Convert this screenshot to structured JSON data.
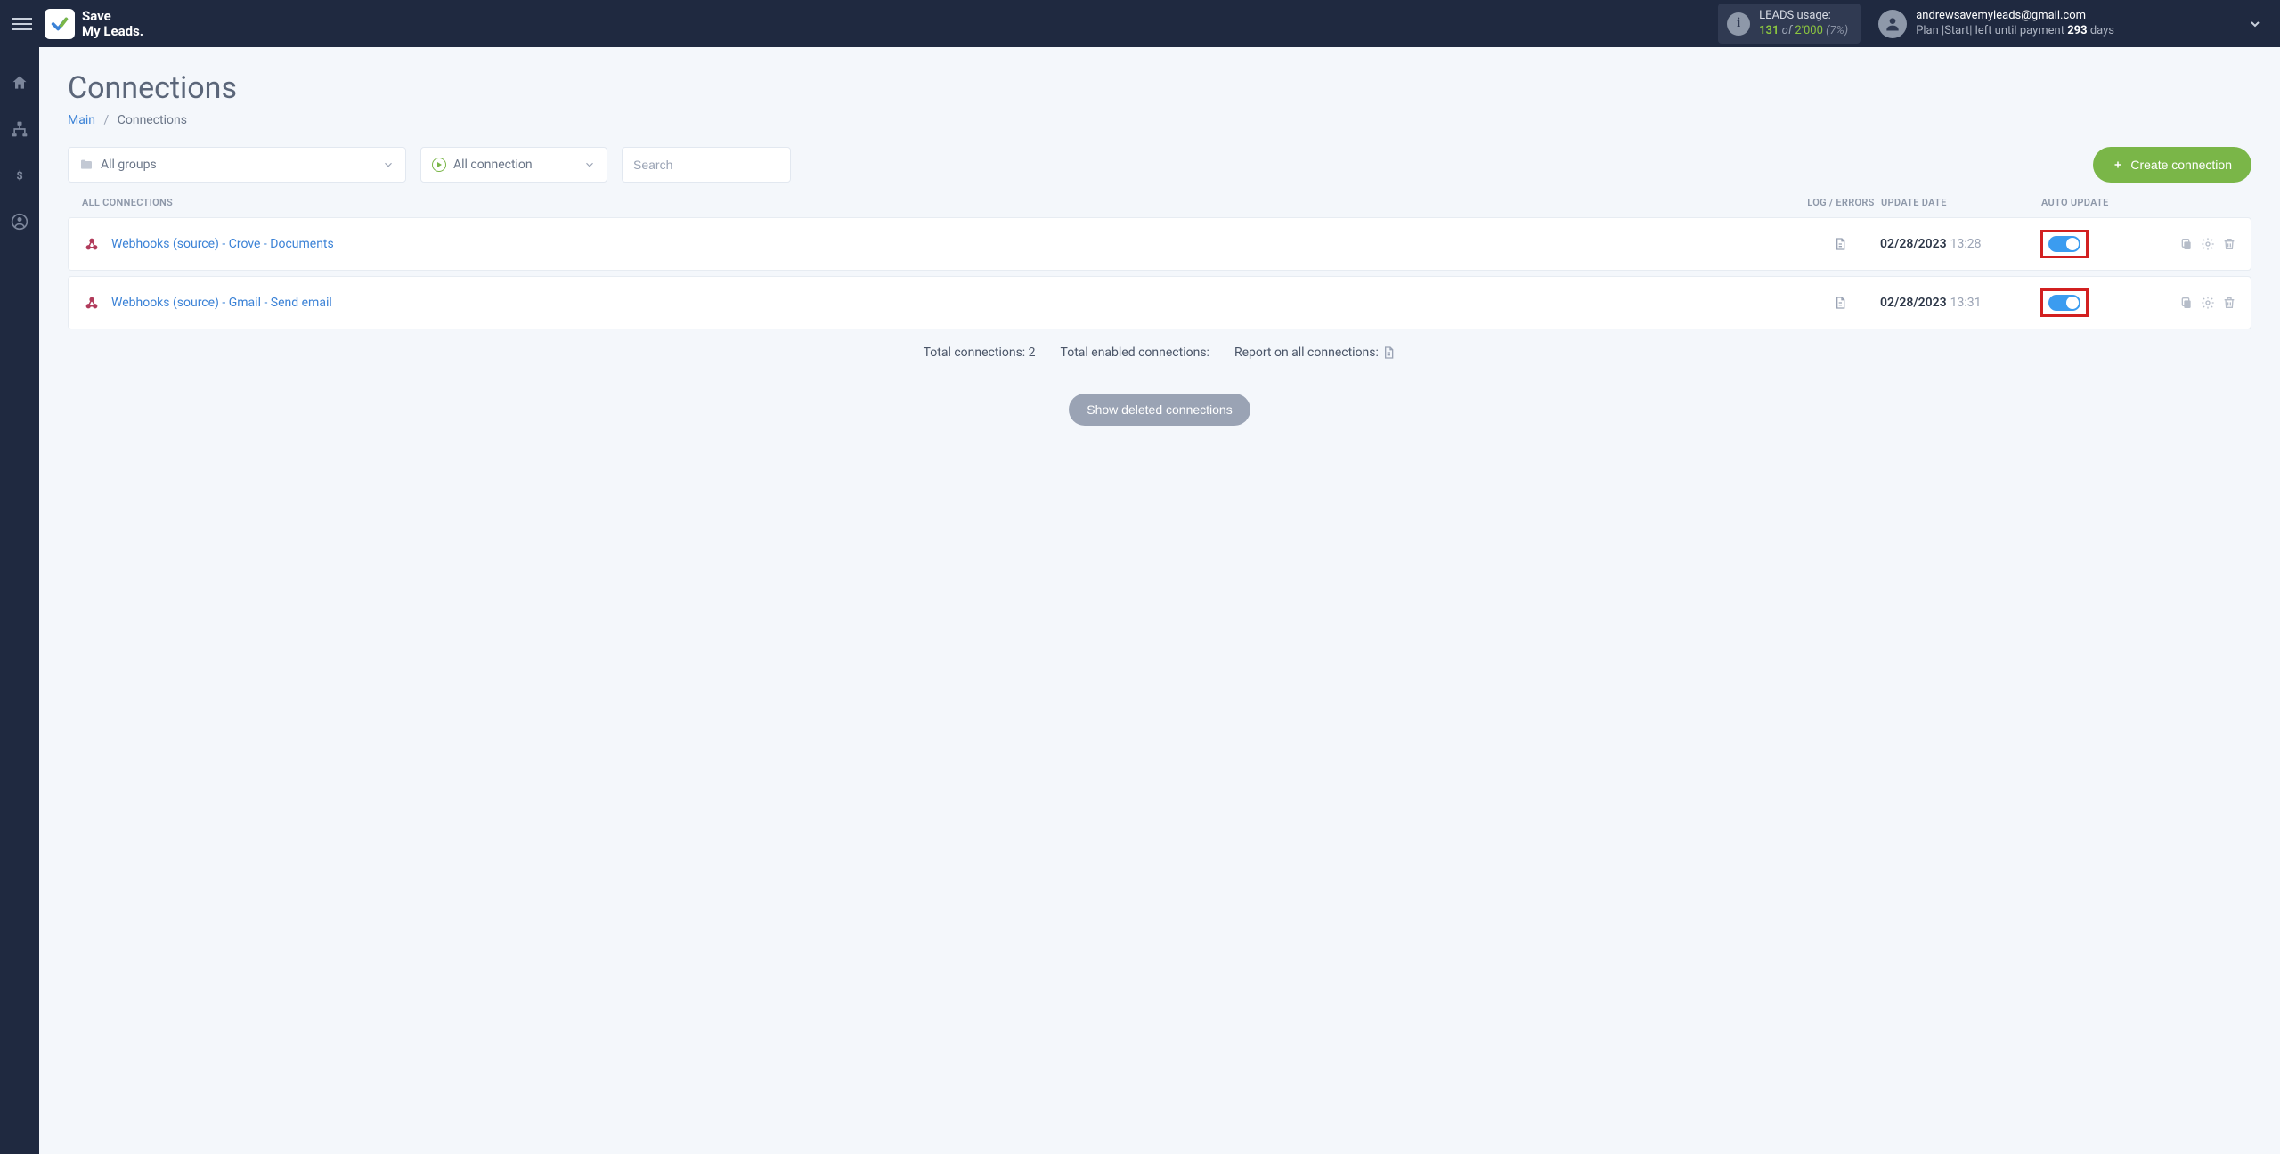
{
  "app": {
    "name": "Save\nMy Leads."
  },
  "usage": {
    "label": "LEADS usage:",
    "used": "131",
    "of": "of",
    "total": "2'000",
    "pct": "(7%)"
  },
  "account": {
    "email": "andrewsavemyleads@gmail.com",
    "plan_prefix": "Plan |Start| left until payment ",
    "days_num": "293",
    "days_suffix": " days"
  },
  "page": {
    "title": "Connections",
    "breadcrumb_main": "Main",
    "breadcrumb_current": "Connections"
  },
  "filters": {
    "groups": "All groups",
    "connection": "All connection",
    "search_placeholder": "Search"
  },
  "create_btn": "Create connection",
  "table_headers": {
    "all": "ALL CONNECTIONS",
    "log": "LOG / ERRORS",
    "date": "UPDATE DATE",
    "auto": "AUTO UPDATE"
  },
  "rows": [
    {
      "name": "Webhooks (source) - Crove - Documents",
      "date": "02/28/2023",
      "time": "13:28"
    },
    {
      "name": "Webhooks (source) - Gmail - Send email",
      "date": "02/28/2023",
      "time": "13:31"
    }
  ],
  "summary": {
    "total": "Total connections: 2",
    "enabled": "Total enabled connections:",
    "report": "Report on all connections:"
  },
  "show_deleted": "Show deleted connections"
}
